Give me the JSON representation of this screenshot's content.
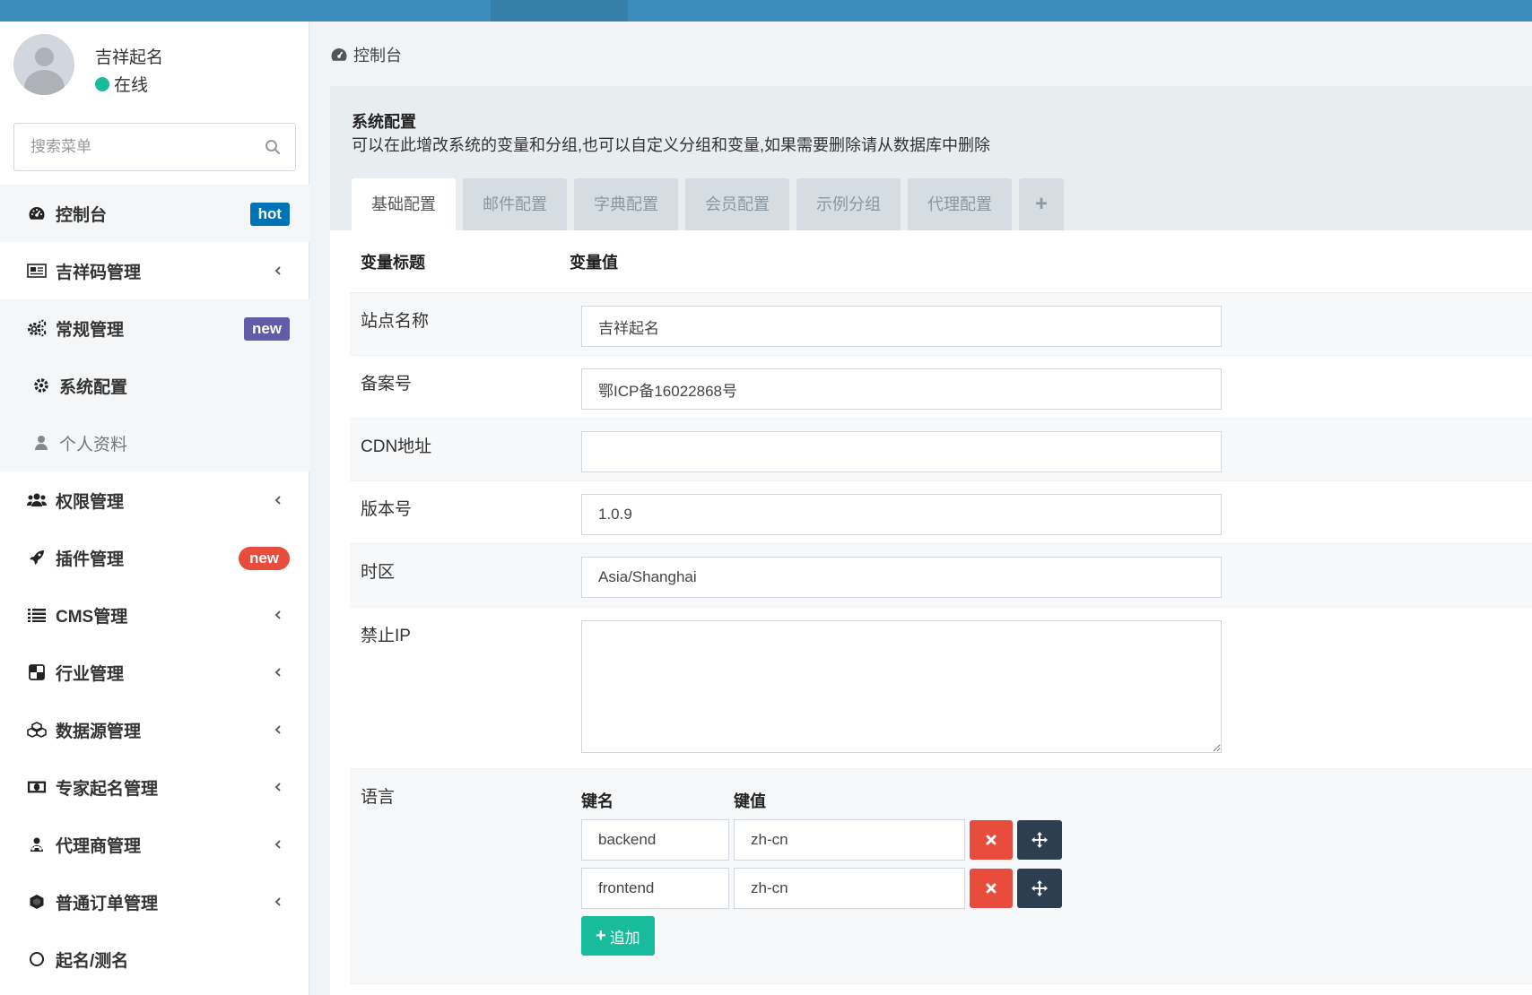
{
  "user": {
    "name": "吉祥起名",
    "status": "在线"
  },
  "search": {
    "placeholder": "搜索菜单"
  },
  "menu": {
    "dashboard": {
      "label": "控制台",
      "badge": "hot"
    },
    "jixiangma": {
      "label": "吉祥码管理"
    },
    "general": {
      "label": "常规管理",
      "badge": "new"
    },
    "general_sub": [
      {
        "label": "系统配置"
      },
      {
        "label": "个人资料"
      }
    ],
    "auth": {
      "label": "权限管理"
    },
    "addon": {
      "label": "插件管理",
      "badge": "new"
    },
    "cms": {
      "label": "CMS管理"
    },
    "industry": {
      "label": "行业管理"
    },
    "datasource": {
      "label": "数据源管理"
    },
    "expert": {
      "label": "专家起名管理"
    },
    "agent": {
      "label": "代理商管理"
    },
    "order": {
      "label": "普通订单管理"
    },
    "naming": {
      "label": "起名/测名"
    }
  },
  "breadcrumb": {
    "label": "控制台"
  },
  "panel": {
    "title": "系统配置",
    "description": "可以在此增改系统的变量和分组,也可以自定义分组和变量,如果需要删除请从数据库中删除",
    "tabs": [
      "基础配置",
      "邮件配置",
      "字典配置",
      "会员配置",
      "示例分组",
      "代理配置"
    ],
    "add_tab": "+"
  },
  "table": {
    "col_title": "变量标题",
    "col_value": "变量值",
    "rows": [
      {
        "label": "站点名称",
        "value": "吉祥起名"
      },
      {
        "label": "备案号",
        "value": "鄂ICP备16022868号"
      },
      {
        "label": "CDN地址",
        "value": ""
      },
      {
        "label": "版本号",
        "value": "1.0.9"
      },
      {
        "label": "时区",
        "value": "Asia/Shanghai"
      },
      {
        "label": "禁止IP",
        "value": ""
      }
    ],
    "language": {
      "label": "语言",
      "key_header": "键名",
      "value_header": "键值",
      "entries": [
        {
          "key": "backend",
          "value": "zh-cn"
        },
        {
          "key": "frontend",
          "value": "zh-cn"
        }
      ],
      "add_label": "追加"
    }
  },
  "colors": {
    "topbar": "#3c8dbc",
    "success": "#18bc9c",
    "danger": "#e74c3c",
    "dark": "#2c3e50",
    "badge_hot": "#0073b7",
    "badge_purple": "#605ca8"
  }
}
